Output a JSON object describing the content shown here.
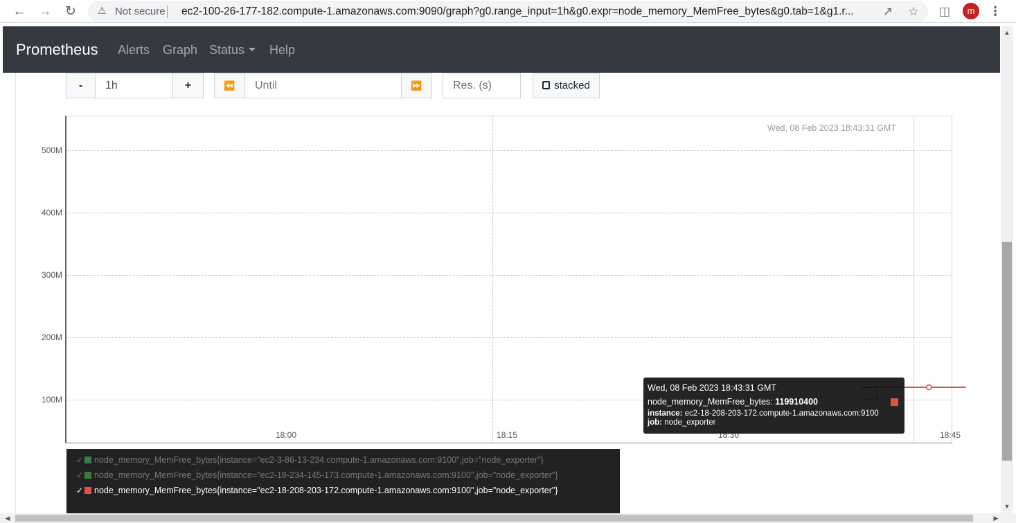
{
  "browser": {
    "security_label": "Not secure",
    "url": "ec2-100-26-177-182.compute-1.amazonaws.com:9090/graph?g0.range_input=1h&g0.expr=node_memory_MemFree_bytes&g0.tab=1&g1.r...",
    "profile_initial": "m",
    "icons": [
      "back-arrow-icon",
      "forward-arrow-icon",
      "reload-icon",
      "warning-icon",
      "share-icon",
      "star-icon",
      "side-panel-icon",
      "kebab-menu-icon"
    ]
  },
  "navbar": {
    "brand": "Prometheus",
    "links": {
      "alerts": "Alerts",
      "graph": "Graph",
      "status": "Status",
      "help": "Help"
    }
  },
  "controls": {
    "minus_label": "-",
    "range_value": "1h",
    "plus_label": "+",
    "back_label": "⏪",
    "until_placeholder": "Until",
    "forward_label": "⏩",
    "res_placeholder": "Res. (s)",
    "stacked_label": "stacked"
  },
  "chart_data": {
    "type": "line",
    "y_ticks": [
      "500M",
      "400M",
      "300M",
      "200M",
      "100M"
    ],
    "x_ticks": [
      "18:00",
      "18:15",
      "18:30",
      "18:45"
    ],
    "hover_timestamp": "Wed, 08 Feb 2023 18:43:31 GMT",
    "series": [
      {
        "name": "node_memory_MemFree_bytes{instance=\"ec2-3-86-13-234.compute-1.amazonaws.com:9100\",job=\"node_exporter\"}",
        "color": "#3c7d4b",
        "active": false,
        "x": [
          "18:39",
          "18:46"
        ],
        "values": [
          119800000,
          119800000
        ]
      },
      {
        "name": "node_memory_MemFree_bytes{instance=\"ec2-18-234-145-173.compute-1.amazonaws.com:9100\",job=\"node_exporter\"}",
        "color": "#3a7d3a",
        "active": false,
        "x": [
          "18:39",
          "18:46"
        ],
        "values": [
          119850000,
          119850000
        ]
      },
      {
        "name": "node_memory_MemFree_bytes{instance=\"ec2-18-208-203-172.compute-1.amazonaws.com:9100\",job=\"node_exporter\"}",
        "color": "#e05243",
        "active": true,
        "x": [
          "18:39",
          "18:40",
          "18:43:31",
          "18:46"
        ],
        "values": [
          100000000,
          119910400,
          119910400,
          119910400
        ]
      }
    ],
    "tooltip": {
      "date": "Wed, 08 Feb 2023 18:43:31 GMT",
      "metric_name": "node_memory_MemFree_bytes:",
      "metric_value": "119910400",
      "instance_key": "instance:",
      "instance_value": "ec2-18-208-203-172.compute-1.amazonaws.com:9100",
      "job_key": "job:",
      "job_value": "node_exporter"
    }
  }
}
